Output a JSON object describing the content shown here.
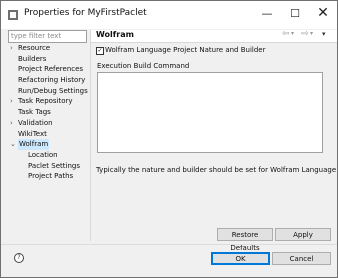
{
  "window": {
    "title": "Properties for MyFirstPaclet",
    "minimize_glyph": "—",
    "maximize_glyph": "☐",
    "close_glyph": "✕"
  },
  "filter": {
    "placeholder": "type filter text"
  },
  "tree": {
    "items": [
      {
        "label": "Resource",
        "arrow": "›"
      },
      {
        "label": "Builders",
        "arrow": ""
      },
      {
        "label": "Project References",
        "arrow": ""
      },
      {
        "label": "Refactoring History",
        "arrow": ""
      },
      {
        "label": "Run/Debug Settings",
        "arrow": ""
      },
      {
        "label": "Task Repository",
        "arrow": "›"
      },
      {
        "label": "Task Tags",
        "arrow": ""
      },
      {
        "label": "Validation",
        "arrow": "›"
      },
      {
        "label": "WikiText",
        "arrow": ""
      },
      {
        "label": "Wolfram",
        "arrow": "⌄"
      },
      {
        "label": "Location",
        "arrow": ""
      },
      {
        "label": "Paclet Settings",
        "arrow": ""
      },
      {
        "label": "Project Paths",
        "arrow": ""
      }
    ]
  },
  "page": {
    "title": "Wolfram",
    "nav": {
      "back": "⇦",
      "forward": "⇨",
      "dropdown": "▾",
      "menu": "▾"
    },
    "checkbox_label": "Wolfram Language Project Nature and Builder",
    "checkbox_checked": "✓",
    "exec_label": "Execution Build Command",
    "exec_value": "",
    "note": "Typically the nature and builder should be set for Wolfram Language work"
  },
  "buttons": {
    "restore_defaults": "Restore Defaults",
    "apply": "Apply",
    "ok": "OK",
    "cancel": "Cancel"
  },
  "help": {
    "glyph": "?"
  },
  "icons": {
    "app": "properties-icon",
    "help": "help-icon",
    "back": "back-arrow-icon",
    "forward": "forward-arrow-icon",
    "menu": "view-menu-icon"
  }
}
